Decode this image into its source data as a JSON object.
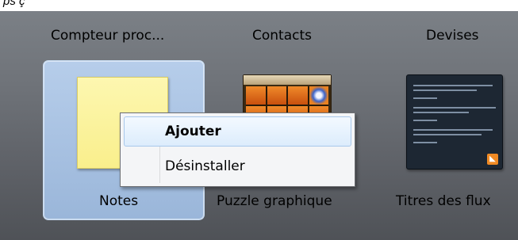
{
  "top_strip_text": "ps ç ",
  "gadgets": [
    {
      "name": "Compteur proc..."
    },
    {
      "name": "Contacts"
    },
    {
      "name": "Devises"
    },
    {
      "name": "Notes"
    },
    {
      "name": "Puzzle graphique"
    },
    {
      "name": "Titres des flux"
    }
  ],
  "context_menu": {
    "items": [
      {
        "label": "Ajouter"
      },
      {
        "label": "Désinstaller"
      }
    ]
  },
  "icons": [
    "sticky-note-icon",
    "puzzle-thumbnail-icon",
    "feed-headlines-thumbnail-icon",
    "rss-icon"
  ],
  "colors": {
    "selection": "#a0bee4",
    "note": "#f9ef8c",
    "puzzle_orange": "#e0721e",
    "rss": "#f08a24"
  }
}
